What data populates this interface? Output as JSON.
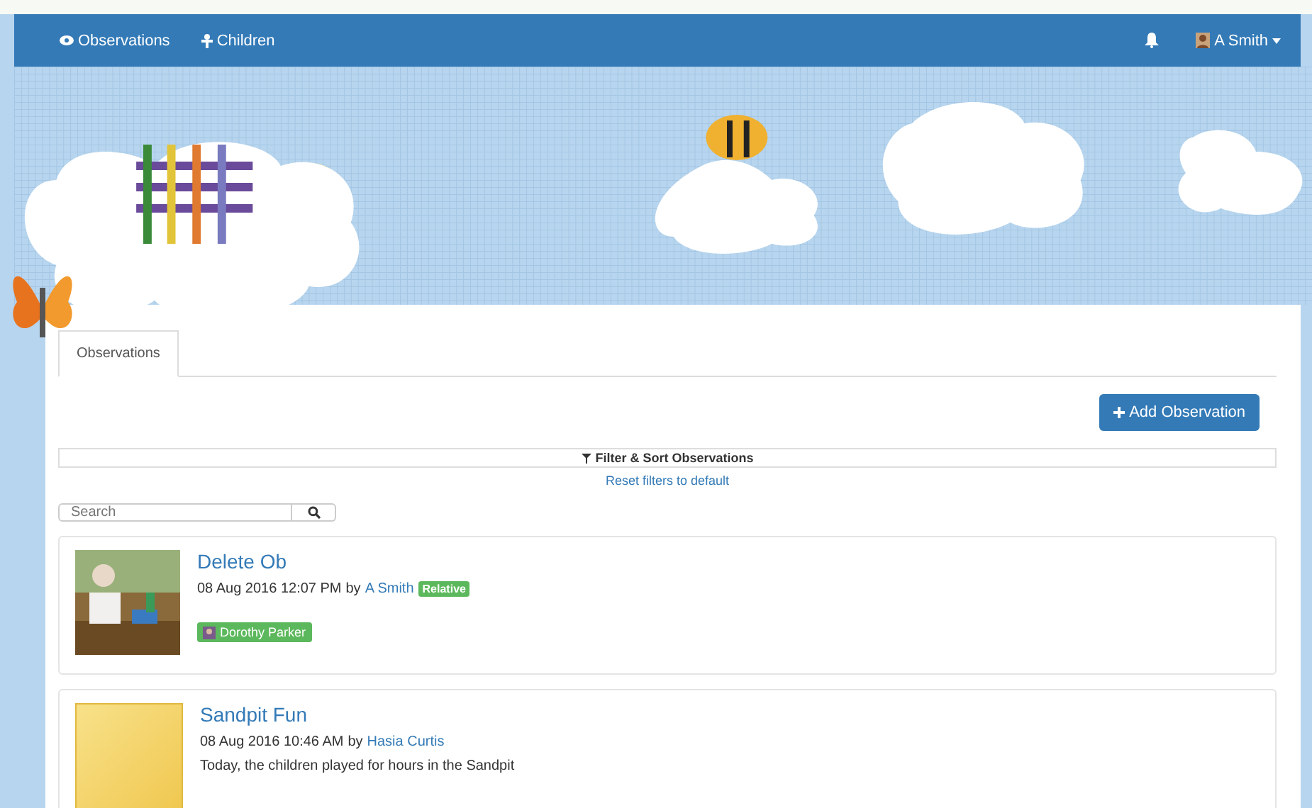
{
  "navbar": {
    "items": [
      {
        "label": "Observations"
      },
      {
        "label": "Children"
      }
    ],
    "user": {
      "label": "A Smith"
    }
  },
  "tabs": [
    {
      "label": "Observations",
      "selected": true
    }
  ],
  "add_button": "Add Observation",
  "filter_button": "Filter & Sort Observations",
  "reset_link": "Reset filters to default",
  "search": {
    "placeholder": "Search"
  },
  "observations": [
    {
      "title": "Delete Ob",
      "date": "08 Aug 2016 12:07 PM",
      "by": "by",
      "author": "A Smith",
      "role": "Relative",
      "kind": "picture",
      "children": [
        "Dorothy Parker"
      ]
    },
    {
      "title": "Sandpit Fun",
      "date": "08 Aug 2016 10:46 AM",
      "by": "by",
      "author": "Hasia Curtis",
      "kind": "placeholder",
      "text": "Today, the children played for hours in the Sandpit"
    }
  ]
}
